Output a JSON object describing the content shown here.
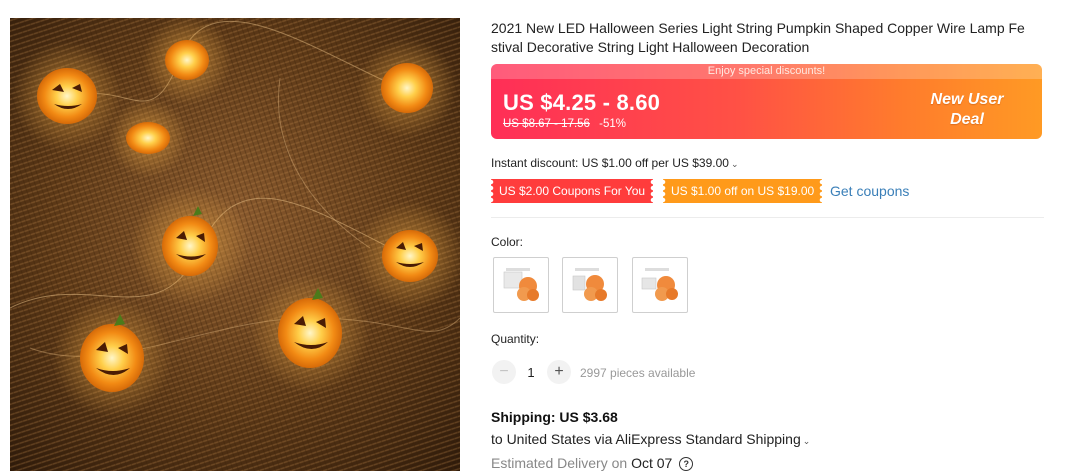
{
  "product": {
    "title_line1": "2021 New LED Halloween Series Light String Pumpkin Shaped Copper Wire Lamp Fe",
    "title_line2": "stival Decorative String Light Halloween Decoration",
    "image_icon": "pumpkin-string-light-photo"
  },
  "price": {
    "enjoy_text": "Enjoy special discounts!",
    "current_range": "US $4.25 - 8.60",
    "original_range": "US $8.67 - 17.56",
    "discount_percent": "-51%",
    "new_user_line1": "New User",
    "new_user_line2": "Deal",
    "colors": {
      "gradient_start": "#ff2e57",
      "gradient_end": "#ff9a24"
    }
  },
  "discounts": {
    "instant_text": "Instant discount: US $1.00 off per US $39.00",
    "coupon_1": "US $2.00 Coupons For You",
    "coupon_2": "US $1.00 off on US $19.00",
    "get_coupons_label": "Get coupons",
    "colors": {
      "coupon_1": "#ff3c3c",
      "coupon_2": "#ff9a1a",
      "link": "#3a7fb8"
    }
  },
  "color_section": {
    "label": "Color:",
    "swatches": [
      "swatch-1",
      "swatch-2",
      "swatch-3"
    ]
  },
  "quantity": {
    "label": "Quantity:",
    "minus": "−",
    "plus": "+",
    "value": "1",
    "available": "2997 pieces available"
  },
  "shipping": {
    "title": "Shipping: US $3.68",
    "destination": "to United States via AliExpress Standard Shipping",
    "estimated_label": "Estimated Delivery on",
    "estimated_date": "Oct 07",
    "help_glyph": "?"
  }
}
